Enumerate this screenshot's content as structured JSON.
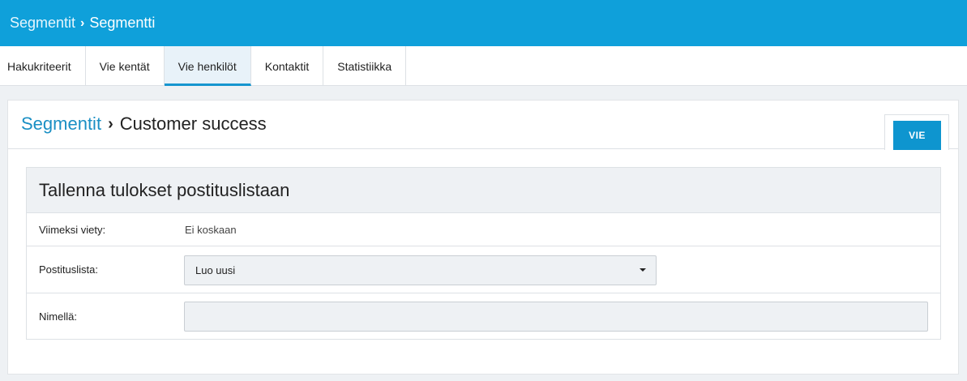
{
  "header": {
    "breadcrumb_parent": "Segmentit",
    "breadcrumb_separator": "›",
    "breadcrumb_current": "Segmentti",
    "bg_color": "#0fa0da"
  },
  "tabs": [
    {
      "label": "Hakukriteerit",
      "active": false
    },
    {
      "label": "Vie kentät",
      "active": false
    },
    {
      "label": "Vie henkilöt",
      "active": true
    },
    {
      "label": "Kontaktit",
      "active": false
    },
    {
      "label": "Statistiikka",
      "active": false
    }
  ],
  "panel": {
    "breadcrumb_link": "Segmentit",
    "breadcrumb_separator": "›",
    "breadcrumb_current": "Customer success",
    "export_button": "VIE",
    "accent_color": "#0e95cf"
  },
  "form": {
    "title": "Tallenna tulokset postituslistaan",
    "last_exported_label": "Viimeksi viety:",
    "last_exported_value": "Ei koskaan",
    "mailing_list_label": "Postituslista:",
    "mailing_list_selected": "Luo uusi",
    "name_label": "Nimellä:",
    "name_value": ""
  }
}
